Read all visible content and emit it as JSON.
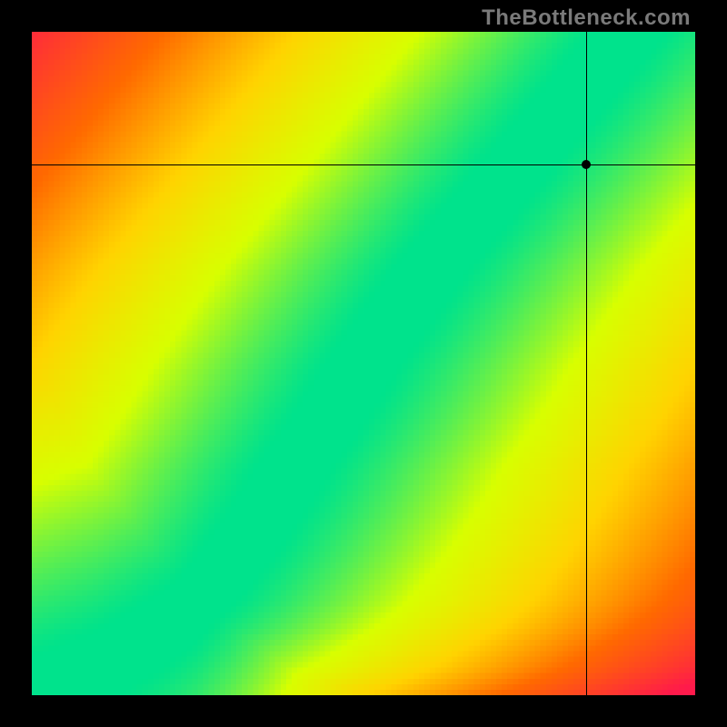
{
  "watermark_text": "TheBottleneck.com",
  "colors": {
    "background": "#000000",
    "watermark": "#7a7a7a",
    "heat_low": "#ff1a4b",
    "heat_mid_low": "#ff6a00",
    "heat_mid": "#ffd400",
    "heat_mid_high": "#d8ff00",
    "heat_high": "#00e38c",
    "crosshair": "#000000"
  },
  "chart_data": {
    "type": "heatmap",
    "description": "Normalized bottleneck fitness surface. x = CPU score (0..1), y = GPU score (0..1). Green ridge = balanced pairing; red = heavy bottleneck; yellow/orange = moderate.",
    "xlabel": "",
    "ylabel": "",
    "x_range": [
      0,
      1
    ],
    "y_range": [
      0,
      1
    ],
    "grid_resolution": 120,
    "ridge_curve_points": [
      [
        0.0,
        0.0
      ],
      [
        0.05,
        0.02
      ],
      [
        0.1,
        0.04
      ],
      [
        0.15,
        0.07
      ],
      [
        0.2,
        0.1
      ],
      [
        0.25,
        0.14
      ],
      [
        0.3,
        0.2
      ],
      [
        0.35,
        0.27
      ],
      [
        0.4,
        0.35
      ],
      [
        0.45,
        0.42
      ],
      [
        0.5,
        0.5
      ],
      [
        0.55,
        0.57
      ],
      [
        0.6,
        0.64
      ],
      [
        0.65,
        0.7
      ],
      [
        0.7,
        0.76
      ],
      [
        0.75,
        0.82
      ],
      [
        0.8,
        0.88
      ],
      [
        0.85,
        0.94
      ],
      [
        0.9,
        1.0
      ]
    ],
    "ridge_half_width_norm": 0.055,
    "falloff_exponent": 1.3,
    "crosshair": {
      "x": 0.835,
      "y": 0.8
    }
  }
}
